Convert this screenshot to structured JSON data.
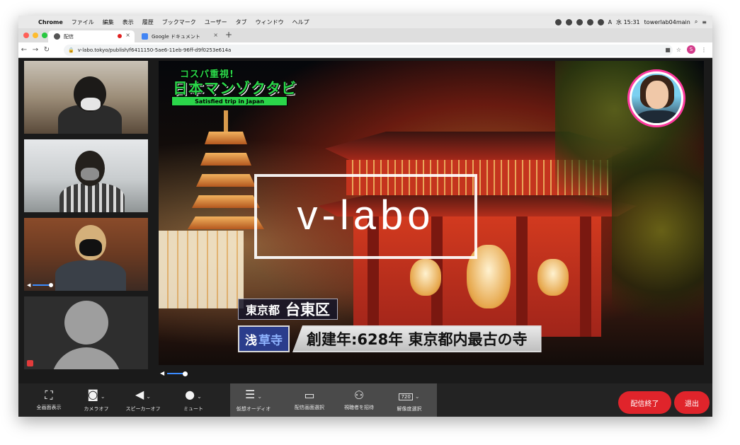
{
  "menubar": {
    "app_name": "Chrome",
    "items": [
      "ファイル",
      "編集",
      "表示",
      "履歴",
      "ブックマーク",
      "ユーザー",
      "タブ",
      "ウィンドウ",
      "ヘルプ"
    ],
    "time": "水 15:31",
    "user": "towerlab04main",
    "input_source": "A"
  },
  "tabs": [
    {
      "title": "配信",
      "active": true
    },
    {
      "title": "Google ドキュメント",
      "active": false
    }
  ],
  "address_bar": {
    "url": "v-labo.tokyo/publish/f6411150-5ae6-11eb-96ff-d9f0253e614a",
    "profile_initial": "S"
  },
  "overlay": {
    "logo_line1": "コスパ重視!",
    "logo_line2": "日本マンゾクタビ",
    "logo_line3": "Satisfied trip in Japan",
    "watermark": "v-labo",
    "caption_location_pref": "東京都",
    "caption_location_ward": "台東区",
    "caption_tag_a": "浅",
    "caption_tag_b": "草寺",
    "caption_main": "創建年:628年 東京都内最古の寺"
  },
  "colors": {
    "accent_red": "#e0242b",
    "logo_green": "#2bd64a",
    "pip_border": "#ff3aa0",
    "volume_blue": "#3b8bff"
  },
  "controls": {
    "fullscreen": "全画面表示",
    "camera_off": "カメラオフ",
    "speaker_off": "スピーカーオフ",
    "mute": "ミュート",
    "virtual_audio": "仮想オーディオ",
    "select_screen": "配信画面選択",
    "invite_viewers": "視聴者を招待",
    "resolution": "解像度選択",
    "resolution_value": "720",
    "end_stream": "配信終了",
    "leave": "退出"
  },
  "icons": {
    "fullscreen": "fullscreen-icon",
    "camera": "camera-icon",
    "speaker": "speaker-icon",
    "mic": "mic-icon",
    "virtual_audio": "sliders-icon",
    "select_screen": "screens-icon",
    "invite": "invite-people-icon",
    "resolution": "monitor-icon"
  }
}
